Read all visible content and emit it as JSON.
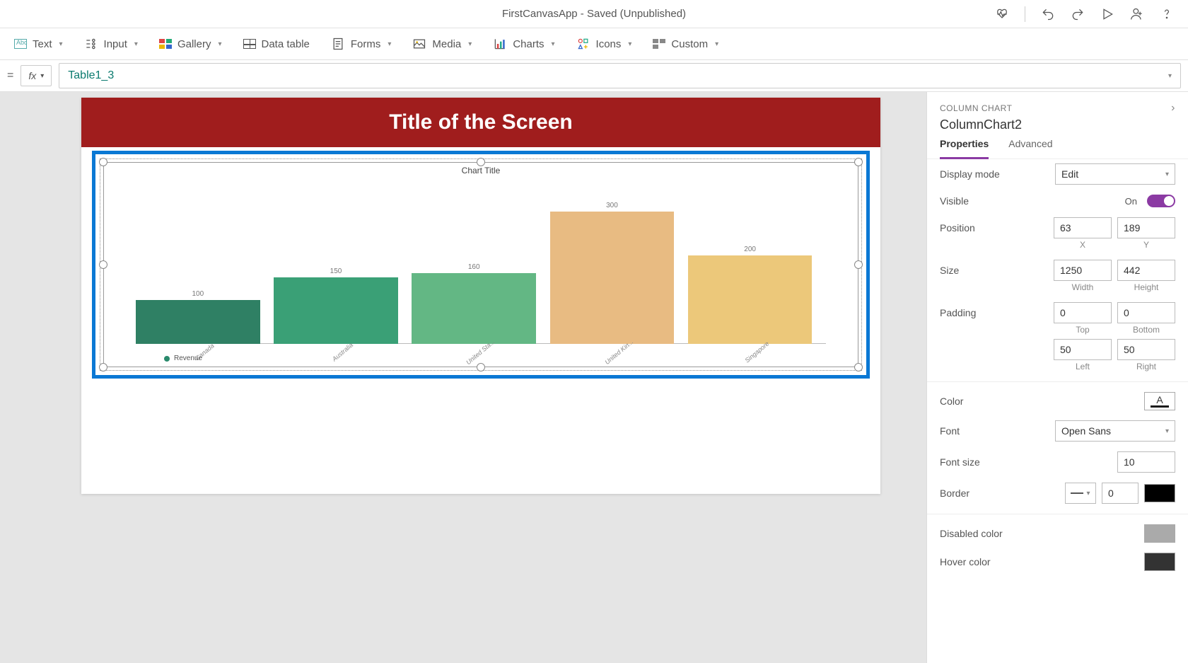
{
  "app": {
    "title": "FirstCanvasApp - Saved (Unpublished)"
  },
  "insertbar": {
    "text": "Text",
    "input": "Input",
    "gallery": "Gallery",
    "datatable": "Data table",
    "forms": "Forms",
    "media": "Media",
    "charts": "Charts",
    "icons": "Icons",
    "custom": "Custom"
  },
  "formula": {
    "value": "Table1_3"
  },
  "canvas": {
    "screen_title": "Title of the Screen",
    "chart_inner_title": "Chart Title",
    "legend": "Revenue"
  },
  "chart_data": {
    "type": "bar",
    "title": "Chart Title",
    "legend": "Revenue",
    "xlabel": "",
    "ylabel": "",
    "ylim": [
      0,
      300
    ],
    "categories": [
      "Canada",
      "Australia",
      "United Sta...",
      "United Kin...",
      "Singapore"
    ],
    "values": [
      100,
      150,
      160,
      300,
      200
    ],
    "colors": [
      "#2f8064",
      "#3aa076",
      "#63b784",
      "#e8bb82",
      "#ecc87a"
    ]
  },
  "panel": {
    "crumb": "COLUMN CHART",
    "element_name": "ColumnChart2",
    "tabs": {
      "properties": "Properties",
      "advanced": "Advanced"
    },
    "props": {
      "display_mode": {
        "label": "Display mode",
        "value": "Edit"
      },
      "visible": {
        "label": "Visible",
        "value": "On"
      },
      "position": {
        "label": "Position",
        "x": "63",
        "y": "189",
        "xl": "X",
        "yl": "Y"
      },
      "size": {
        "label": "Size",
        "w": "1250",
        "h": "442",
        "wl": "Width",
        "hl": "Height"
      },
      "padding": {
        "label": "Padding",
        "top": "0",
        "bottom": "0",
        "left": "50",
        "right": "50",
        "tl": "Top",
        "bl": "Bottom",
        "ll": "Left",
        "rl": "Right"
      },
      "color": {
        "label": "Color"
      },
      "font": {
        "label": "Font",
        "value": "Open Sans"
      },
      "font_size": {
        "label": "Font size",
        "value": "10"
      },
      "border": {
        "label": "Border",
        "width": "0"
      },
      "disabled_color": {
        "label": "Disabled color"
      },
      "hover_color": {
        "label": "Hover color"
      }
    }
  }
}
